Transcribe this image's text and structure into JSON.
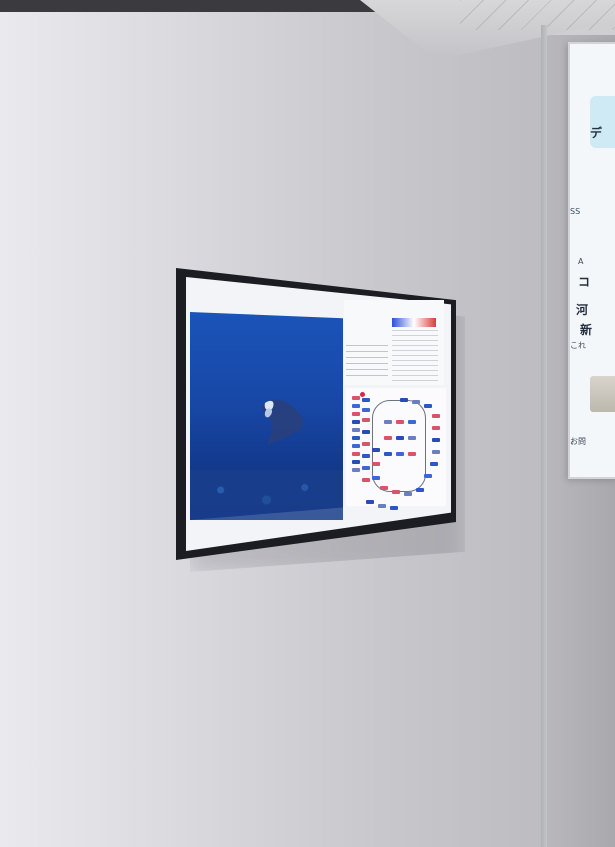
{
  "scene": {
    "description_note": "",
    "colors": {
      "wall": "#d8d8dc",
      "tv_bezel": "#1b1d22",
      "screen_bg": "#f3f4f7",
      "ocean": "#1847a6",
      "accent_cyan": "#cfe9f5"
    }
  },
  "poster": {
    "lines": [
      {
        "text": "デ"
      },
      {
        "text": "SS"
      },
      {
        "text": "A"
      },
      {
        "text": "コ"
      },
      {
        "text": "河"
      },
      {
        "text": "新"
      },
      {
        "text": "これ"
      },
      {
        "text": "お問"
      }
    ]
  }
}
